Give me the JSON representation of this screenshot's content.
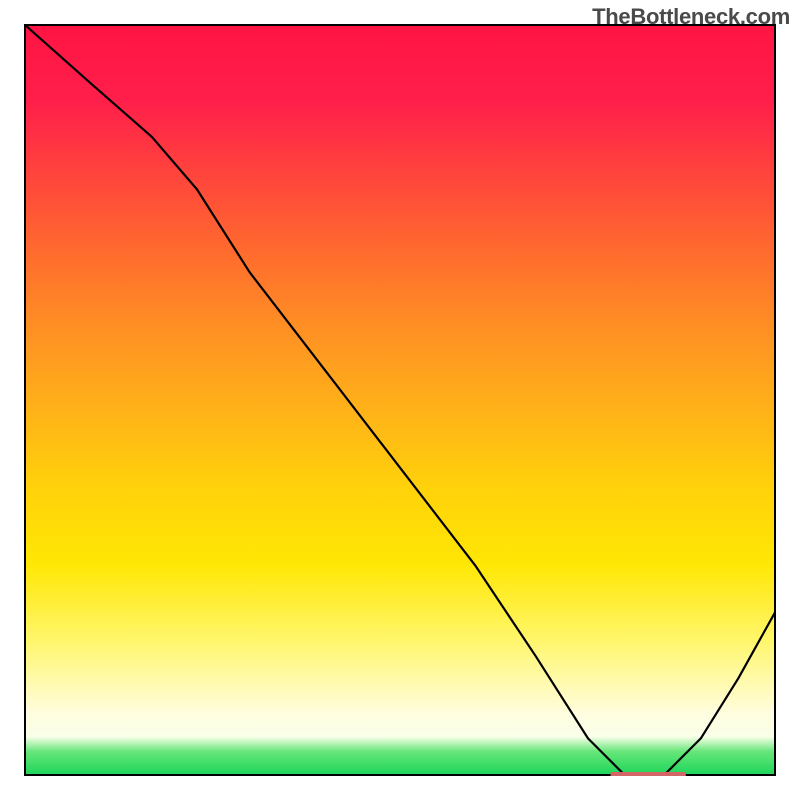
{
  "watermark": "TheBottleneck.com",
  "chart_data": {
    "type": "line",
    "title": "",
    "xlabel": "",
    "ylabel": "",
    "xlim": [
      0,
      100
    ],
    "ylim": [
      0,
      100
    ],
    "grid": false,
    "legend": false,
    "annotations": [],
    "background_gradient": {
      "orientation": "vertical",
      "stops": [
        {
          "pos": 0.0,
          "color": "#ff1444"
        },
        {
          "pos": 0.3,
          "color": "#ff6a2e"
        },
        {
          "pos": 0.52,
          "color": "#ffb418"
        },
        {
          "pos": 0.72,
          "color": "#ffe704"
        },
        {
          "pos": 0.92,
          "color": "#fffde0"
        },
        {
          "pos": 1.0,
          "color": "#1fd65a"
        }
      ]
    },
    "series": [
      {
        "name": "curve",
        "x": [
          0,
          9,
          17,
          23,
          30,
          40,
          50,
          60,
          68,
          75,
          80,
          85,
          90,
          95,
          100
        ],
        "values": [
          100,
          92,
          85,
          78,
          67,
          54,
          41,
          28,
          16,
          5,
          0,
          0,
          5,
          13,
          22
        ]
      }
    ],
    "valley_segment": {
      "x_start": 78,
      "x_end": 88,
      "y": 0,
      "color": "#d26565"
    }
  }
}
